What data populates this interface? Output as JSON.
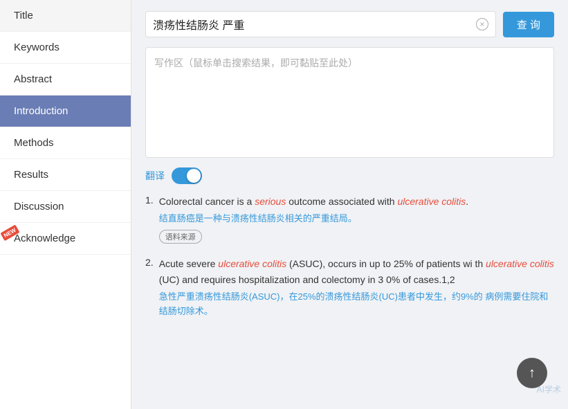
{
  "sidebar": {
    "items": [
      {
        "id": "title",
        "label": "Title",
        "active": false,
        "newBadge": false
      },
      {
        "id": "keywords",
        "label": "Keywords",
        "active": false,
        "newBadge": false
      },
      {
        "id": "abstract",
        "label": "Abstract",
        "active": false,
        "newBadge": false
      },
      {
        "id": "introduction",
        "label": "Introduction",
        "active": true,
        "newBadge": false
      },
      {
        "id": "methods",
        "label": "Methods",
        "active": false,
        "newBadge": false
      },
      {
        "id": "results",
        "label": "Results",
        "active": false,
        "newBadge": false
      },
      {
        "id": "discussion",
        "label": "Discussion",
        "active": false,
        "newBadge": false
      },
      {
        "id": "acknowledge",
        "label": "Acknowledge",
        "active": false,
        "newBadge": true
      }
    ]
  },
  "search": {
    "query": "溃疡性结肠炎 严重",
    "button_label": "查 询",
    "clear_icon": "×"
  },
  "writing_area": {
    "placeholder": "写作区（鼠标单击搜索结果，即可黏贴至此处）"
  },
  "translate": {
    "label": "翻译",
    "enabled": true
  },
  "results": [
    {
      "num": "1.",
      "en_parts": [
        {
          "text": "Colorectal cancer is a ",
          "type": "normal"
        },
        {
          "text": "serious",
          "type": "serious"
        },
        {
          "text": " outcome associated with ",
          "type": "normal"
        },
        {
          "text": "ulcerative colitis",
          "type": "uc-link"
        },
        {
          "text": ".",
          "type": "normal"
        }
      ],
      "en_full": "Colorectal cancer is a serious outcome associated with ulcerative colitis.",
      "cn": "结直肠癌是一种与溃疡性结肠炎相关的严重结局。",
      "cn_highlight_words": [
        "溃疡性结肠炎",
        "严重"
      ],
      "source_tag": "语料来源"
    },
    {
      "num": "2.",
      "en_parts": [
        {
          "text": "Acute severe ",
          "type": "normal"
        },
        {
          "text": "ulcerative colitis",
          "type": "uc-link"
        },
        {
          "text": " (ASUC), occurs in up to 25% of patients with ",
          "type": "normal"
        },
        {
          "text": "ulcerative colitis",
          "type": "uc-link"
        },
        {
          "text": " (UC) and requires hospitalization and colectomy in 30% of cases.1,2",
          "type": "normal"
        }
      ],
      "en_full": "Acute severe ulcerative colitis (ASUC), occurs in up to 25% of patients with ulcerative colitis (UC) and requires hospitalization and colectomy in 30% of cases.1,2",
      "cn": "急性严重溃疡性结肠炎(ASUC)，在25%的溃疡性结肠炎(UC)患者中发生，约9%的病例需要住院和结肠切除术。",
      "cn_highlight_words": [
        "严重溃疡性结肠炎",
        "溃疡性结肠炎",
        "结肠切除术"
      ],
      "source_tag": null
    }
  ],
  "scroll_up": {
    "icon": "↑"
  },
  "watermark": {
    "text": "AI学术"
  }
}
